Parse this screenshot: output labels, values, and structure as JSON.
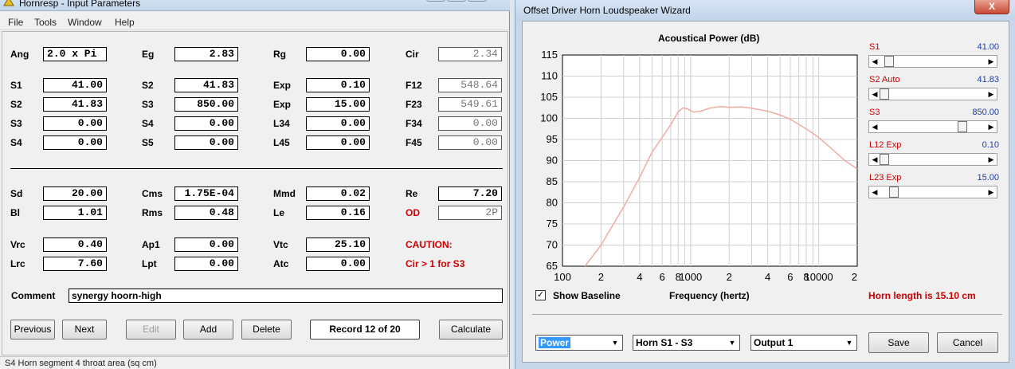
{
  "left_window": {
    "title": "Hornresp - Input Parameters",
    "menu": [
      "File",
      "Tools",
      "Window",
      "Help"
    ],
    "fields": [
      {
        "label": "Ang",
        "value": "2.0 x Pi"
      },
      {
        "label": "Eg",
        "value": "2.83"
      },
      {
        "label": "Rg",
        "value": "0.00"
      },
      {
        "label": "Cir",
        "value": "2.34"
      },
      {
        "label": "S1",
        "value": "41.00"
      },
      {
        "label": "S2",
        "value": "41.83"
      },
      {
        "label": "Exp",
        "value": "0.10"
      },
      {
        "label": "F12",
        "value": "548.64"
      },
      {
        "label": "S2",
        "value": "41.83"
      },
      {
        "label": "S3",
        "value": "850.00"
      },
      {
        "label": "Exp",
        "value": "15.00"
      },
      {
        "label": "F23",
        "value": "549.61"
      },
      {
        "label": "S3",
        "value": "0.00"
      },
      {
        "label": "S4",
        "value": "0.00"
      },
      {
        "label": "L34",
        "value": "0.00"
      },
      {
        "label": "F34",
        "value": "0.00"
      },
      {
        "label": "S4",
        "value": "0.00"
      },
      {
        "label": "S5",
        "value": "0.00"
      },
      {
        "label": "L45",
        "value": "0.00"
      },
      {
        "label": "F45",
        "value": "0.00"
      },
      {
        "label": "Sd",
        "value": "20.00"
      },
      {
        "label": "Cms",
        "value": "1.75E-04"
      },
      {
        "label": "Mmd",
        "value": "0.02"
      },
      {
        "label": "Re",
        "value": "7.20"
      },
      {
        "label": "Bl",
        "value": "1.01"
      },
      {
        "label": "Rms",
        "value": "0.48"
      },
      {
        "label": "Le",
        "value": "0.16"
      },
      {
        "label": "OD",
        "value": "2P"
      },
      {
        "label": "Vrc",
        "value": "0.40"
      },
      {
        "label": "Ap1",
        "value": "0.00"
      },
      {
        "label": "Vtc",
        "value": "25.10"
      },
      {
        "label": "Lrc",
        "value": "7.60"
      },
      {
        "label": "Lpt",
        "value": "0.00"
      },
      {
        "label": "Atc",
        "value": "0.00"
      }
    ],
    "caution": {
      "title": "CAUTION:",
      "message": "Cir > 1 for S3"
    },
    "comment": {
      "label": "Comment",
      "value": "synergy hoorn-high"
    },
    "buttons": {
      "previous": "Previous",
      "next": "Next",
      "edit": "Edit",
      "add": "Add",
      "delete": "Delete",
      "record": "Record 12 of 20",
      "calculate": "Calculate"
    },
    "status": "S4   Horn segment 4 throat area  (sq cm)"
  },
  "right_window": {
    "title": "Offset Driver Horn Loudspeaker Wizard",
    "close": "X",
    "params": [
      {
        "name": "S1",
        "value": "41.00",
        "thumb": 0.05
      },
      {
        "name": "S2 Auto",
        "value": "41.83",
        "thumb": 0.0
      },
      {
        "name": "S3",
        "value": "850.00",
        "thumb": 0.8
      },
      {
        "name": "L12 Exp",
        "value": "0.10",
        "thumb": 0.0
      },
      {
        "name": "L23 Exp",
        "value": "15.00",
        "thumb": 0.1
      }
    ],
    "show_baseline": {
      "label": "Show Baseline",
      "checked": true,
      "mark": "✓"
    },
    "freq_label": "Frequency (hertz)",
    "horn_length": "Horn length is 15.10 cm",
    "combos": {
      "mode": "Power",
      "horn": "Horn S1 - S3",
      "output": "Output 1"
    },
    "buttons": {
      "save": "Save",
      "cancel": "Cancel"
    }
  },
  "chart_data": {
    "type": "line",
    "title": "Acoustical Power (dB)",
    "xlabel": "Frequency (hertz)",
    "ylabel": "",
    "x_scale": "log",
    "xlim": [
      100,
      20000
    ],
    "ylim": [
      65,
      115
    ],
    "yticks": [
      "115",
      "110",
      "105",
      "100",
      "95",
      "90",
      "85",
      "80",
      "75",
      "70",
      "65"
    ],
    "xticks": [
      {
        "x": 100,
        "label": "100"
      },
      {
        "x": 200,
        "label": "2"
      },
      {
        "x": 400,
        "label": "4"
      },
      {
        "x": 600,
        "label": "6"
      },
      {
        "x": 800,
        "label": "8"
      },
      {
        "x": 1000,
        "label": "1000"
      },
      {
        "x": 2000,
        "label": "2"
      },
      {
        "x": 4000,
        "label": "4"
      },
      {
        "x": 6000,
        "label": "6"
      },
      {
        "x": 8000,
        "label": "8"
      },
      {
        "x": 10000,
        "label": "10000"
      },
      {
        "x": 20000,
        "label": "2"
      }
    ],
    "grid": true,
    "line_color": "#f0b0a8",
    "series": [
      {
        "values": [
          [
            150,
            65
          ],
          [
            200,
            70
          ],
          [
            300,
            79
          ],
          [
            400,
            86
          ],
          [
            500,
            92
          ],
          [
            600,
            95.5
          ],
          [
            700,
            98.5
          ],
          [
            800,
            101.5
          ],
          [
            870,
            102.5
          ],
          [
            950,
            102.2
          ],
          [
            1050,
            101.5
          ],
          [
            1200,
            101.7
          ],
          [
            1400,
            102.4
          ],
          [
            1700,
            102.8
          ],
          [
            2000,
            102.6
          ],
          [
            2500,
            102.7
          ],
          [
            3000,
            102.4
          ],
          [
            4000,
            101.7
          ],
          [
            5000,
            100.8
          ],
          [
            6000,
            99.8
          ],
          [
            8000,
            97.5
          ],
          [
            10000,
            95.5
          ],
          [
            13000,
            92.5
          ],
          [
            16000,
            90
          ],
          [
            20000,
            88
          ]
        ]
      }
    ]
  }
}
